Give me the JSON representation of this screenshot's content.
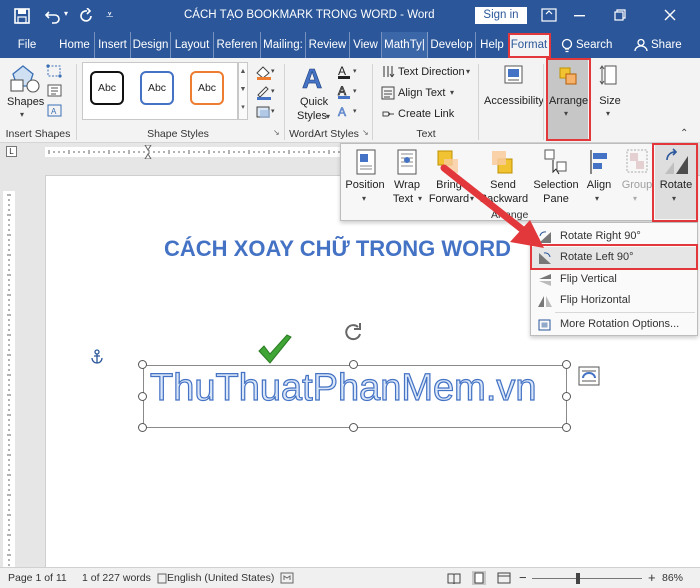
{
  "titlebar": {
    "doc_title": "CÁCH TẠO BOOKMARK TRONG WORD  -  Word",
    "sign_in": "Sign in"
  },
  "tabs": [
    "File",
    "Home",
    "Insert",
    "Design",
    "Layout",
    "Referen",
    "Mailing:",
    "Review",
    "View",
    "MathTy|",
    "Develop",
    "Help",
    "Format"
  ],
  "search": "Search",
  "share": "Share",
  "ribbon": {
    "shapes_label": "Shapes",
    "group_insert_shapes": "Insert Shapes",
    "style_sample": "Abc",
    "group_shape_styles": "Shape Styles",
    "quick_styles": [
      "Quick",
      "Styles"
    ],
    "group_wordart": "WordArt Styles",
    "text_direction": "Text Direction",
    "align_text": "Align Text",
    "create_link": "Create Link",
    "group_text": "Text",
    "accessibility": "Accessibility",
    "arrange": "Arrange",
    "size": "Size"
  },
  "arrange_panel": {
    "position": [
      "Position"
    ],
    "wrap_text": [
      "Wrap",
      "Text"
    ],
    "bring_forward": [
      "Bring",
      "Forward"
    ],
    "send_backward": [
      "Send",
      "Backward"
    ],
    "selection_pane": [
      "Selection",
      "Pane"
    ],
    "align": [
      "Align"
    ],
    "group": [
      "Group"
    ],
    "rotate": [
      "Rotate"
    ],
    "group_label": "Arrange"
  },
  "rotate_menu": [
    "Rotate Right 90°",
    "Rotate Left 90°",
    "Flip Vertical",
    "Flip Horizontal",
    "More Rotation Options..."
  ],
  "document": {
    "heading": "CÁCH XOAY CHỮ TRONG WORD",
    "wordart": "ThuThuatPhanMem.vn"
  },
  "status": {
    "page": "Page 1 of 11",
    "words": "1 of 227 words",
    "language": "English (United States)",
    "zoom": "86%"
  },
  "colors": {
    "title_blue": "#2b579a",
    "heading_blue": "#4472c4",
    "highlight_red": "#e2373b"
  }
}
